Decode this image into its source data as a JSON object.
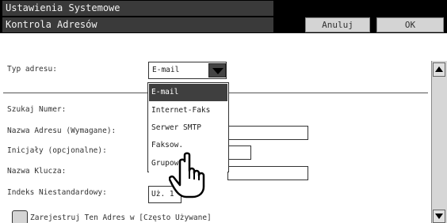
{
  "header": {
    "title": "Ustawienia Systemowe",
    "subtitle": "Kontrola Adresów",
    "cancel_label": "Anuluj",
    "ok_label": "OK"
  },
  "form": {
    "address_type_label": "Typ adresu:",
    "address_type_value": "E-mail",
    "search_number_label": "Szukaj Numer:",
    "address_name_label": "Nazwa Adresu (Wymagane):",
    "initials_label": "Inicjały (opcjonalne):",
    "key_name_label": "Nazwa Klucza:",
    "custom_index_label": "Indeks Niestandardowy:",
    "custom_index_value": "Uż. 1",
    "register_frequent_label": "Zarejestruj Ten Adres w [Często Używane]"
  },
  "dropdown": {
    "selected_index": 0,
    "options": [
      "E-mail",
      "Internet-Faks",
      "Serwer SMTP",
      "Faksow.",
      "Grupow."
    ]
  },
  "icons": {
    "cursor": "hand-pointer-icon",
    "scroll_up": "arrow-up-icon",
    "scroll_down": "arrow-down-icon",
    "select_arrow": "triangle-down-icon"
  }
}
